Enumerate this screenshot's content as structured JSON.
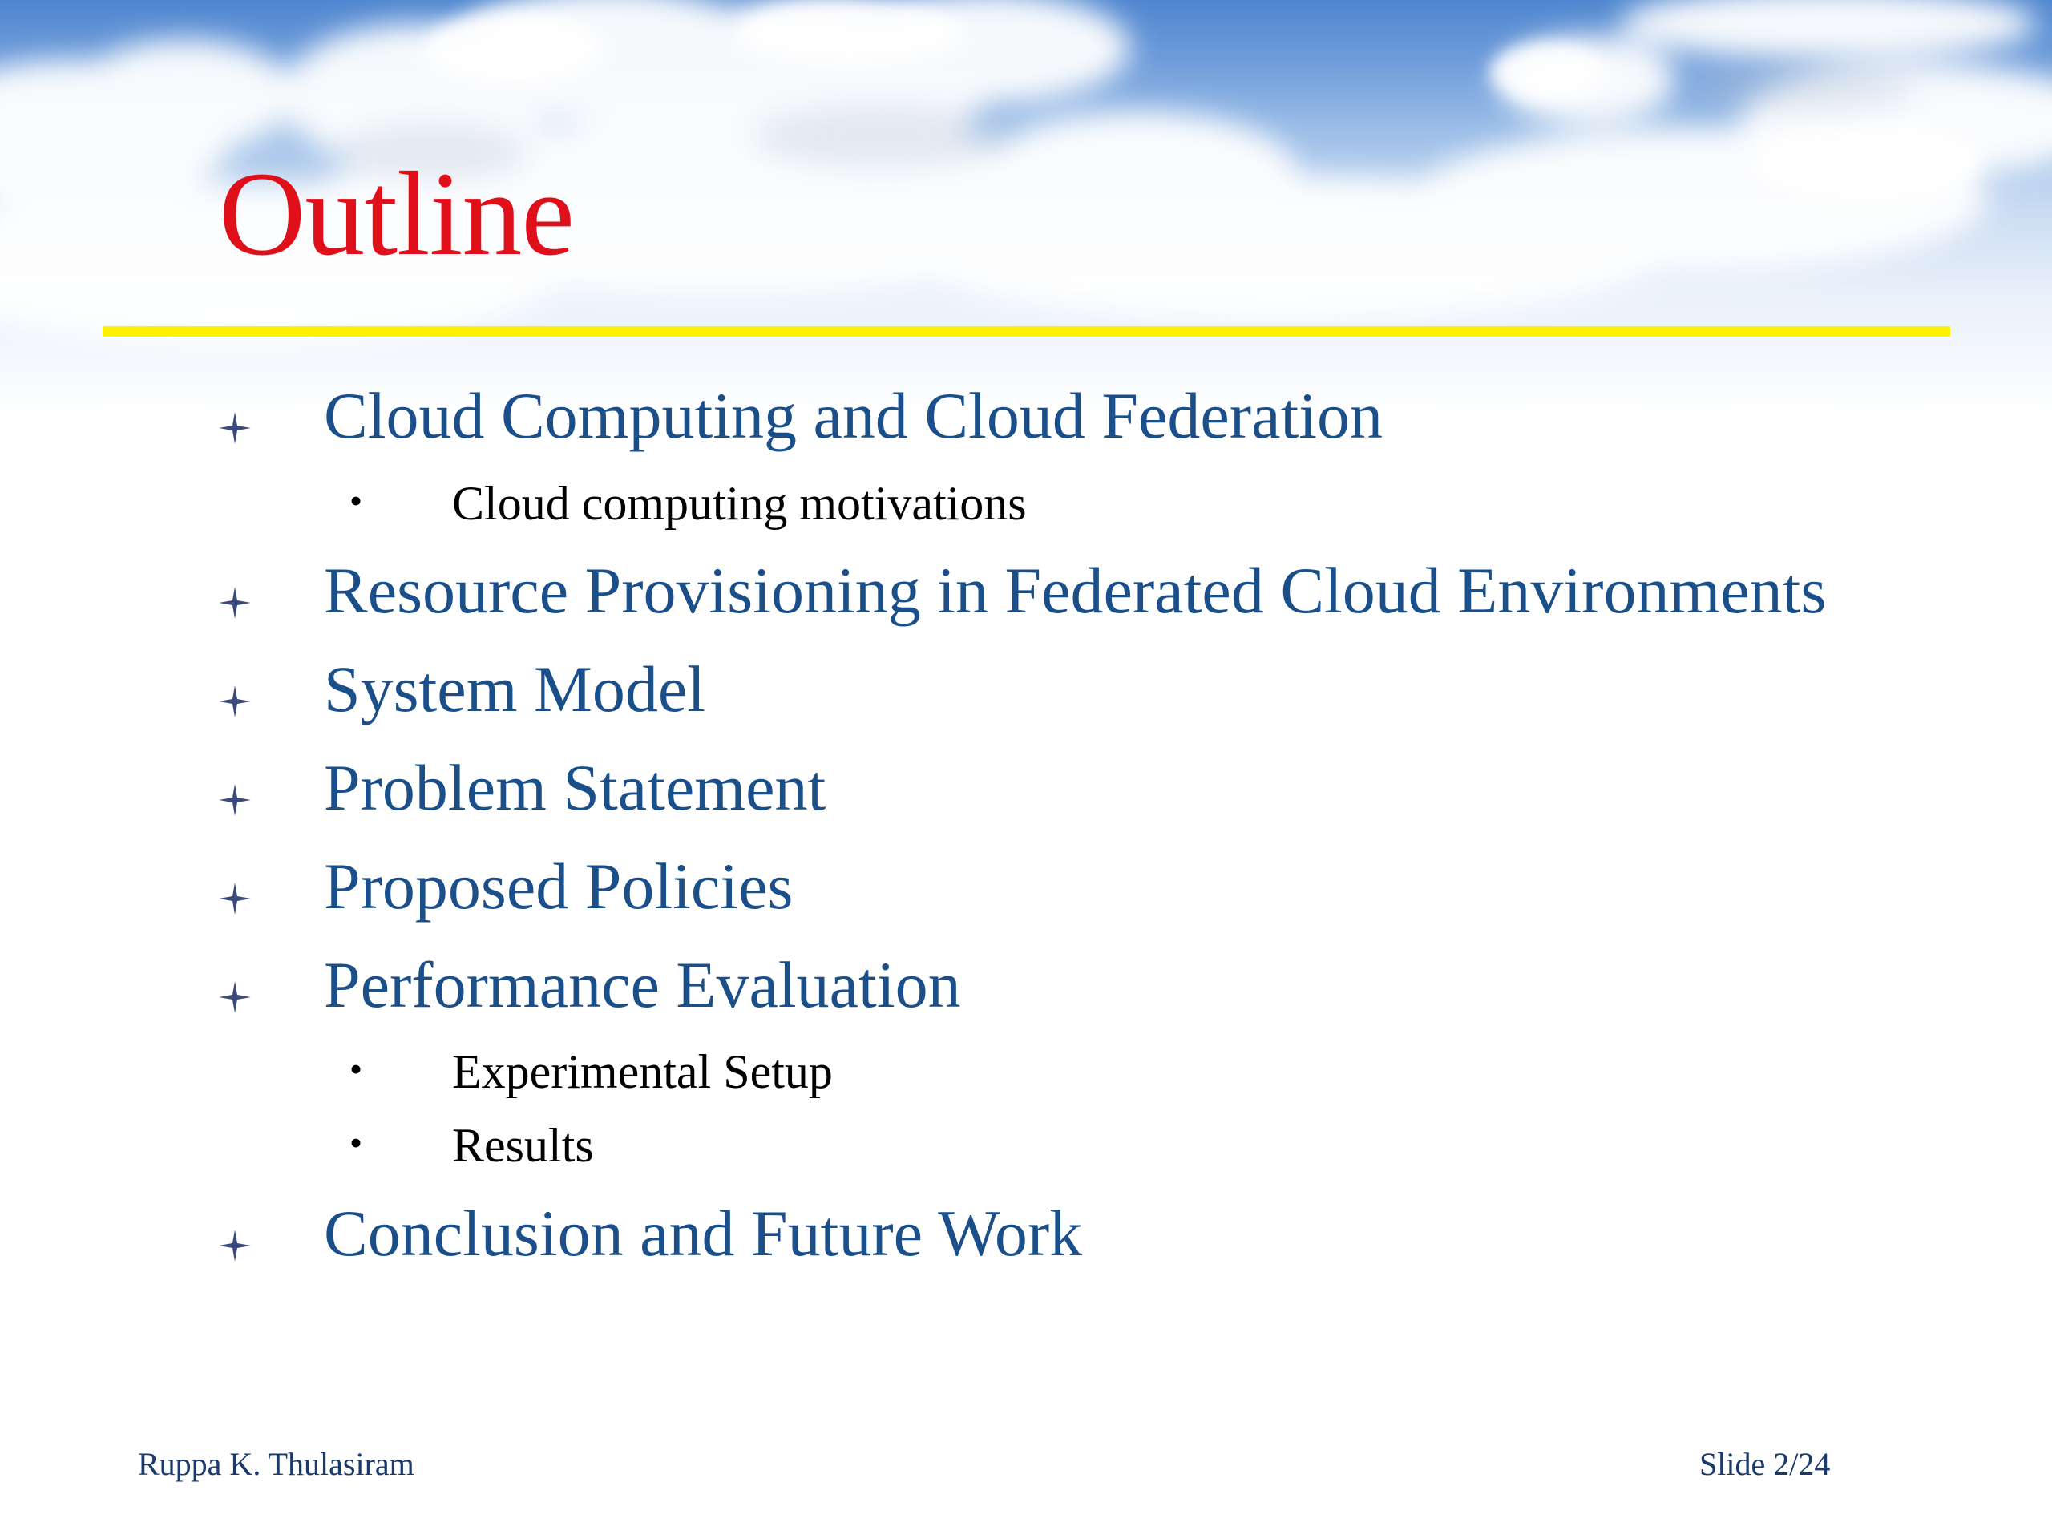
{
  "slide": {
    "title": "Outline",
    "items": [
      {
        "text": "Cloud Computing and Cloud Federation",
        "sub": [
          "Cloud computing motivations"
        ]
      },
      {
        "text": "Resource Provisioning in Federated Cloud Environments",
        "sub": []
      },
      {
        "text": "System Model",
        "sub": []
      },
      {
        "text": "Problem Statement",
        "sub": []
      },
      {
        "text": "Proposed Policies",
        "sub": []
      },
      {
        "text": "Performance Evaluation",
        "sub": [
          "Experimental Setup",
          "Results"
        ]
      },
      {
        "text": "Conclusion and Future Work",
        "sub": []
      }
    ],
    "bullet_icon": "four-point-star-icon",
    "sub_bullet_icon": "bullet-dot-icon",
    "sub_bullet_glyph": "•"
  },
  "footer": {
    "author": "Ruppa K. Thulasiram",
    "slide_number": "Slide 2/24"
  },
  "colors": {
    "title": "#e0101a",
    "item_text": "#1a4f8a",
    "sub_text": "#000000",
    "rule": "#fff200",
    "footer_text": "#1a3a6e",
    "bullet_star": "#3a4a7a"
  }
}
